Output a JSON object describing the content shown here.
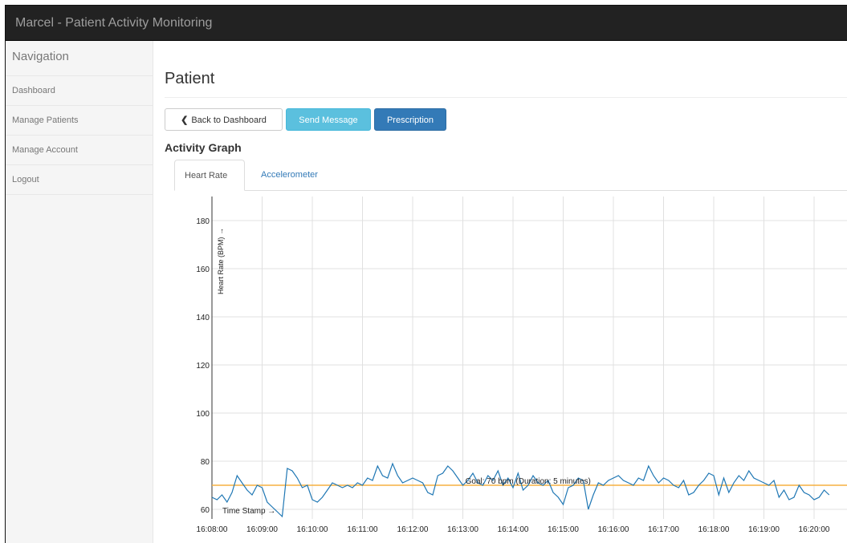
{
  "app": {
    "title": "Marcel - Patient Activity Monitoring"
  },
  "sidebar": {
    "heading": "Navigation",
    "items": [
      {
        "label": "Dashboard"
      },
      {
        "label": "Manage Patients"
      },
      {
        "label": "Manage Account"
      },
      {
        "label": "Logout"
      }
    ]
  },
  "main": {
    "title": "Patient",
    "buttons": {
      "back": "Back to Dashboard",
      "send_message": "Send Message",
      "prescription": "Prescription"
    },
    "section_title": "Activity Graph",
    "tabs": [
      {
        "label": "Heart Rate",
        "active": true
      },
      {
        "label": "Accelerometer",
        "active": false
      }
    ]
  },
  "colors": {
    "series": "#1f77b4",
    "goal": "#f5b041",
    "grid": "#e0e0e0",
    "primary": "#337ab7",
    "info": "#5bc0de"
  },
  "chart_data": {
    "type": "line",
    "ylabel": "Heart Rate (BPM) →",
    "xlabel": "Time Stamp →",
    "ylim": [
      56,
      190
    ],
    "y_ticks": [
      60,
      80,
      100,
      120,
      140,
      160,
      180
    ],
    "x_ticks": [
      "16:08:00",
      "16:09:00",
      "16:10:00",
      "16:11:00",
      "16:12:00",
      "16:13:00",
      "16:14:00",
      "16:15:00",
      "16:16:00",
      "16:17:00",
      "16:18:00",
      "16:19:00",
      "16:20:00"
    ],
    "xlim_minutes": [
      0,
      12.3
    ],
    "grid": true,
    "goal": {
      "value": 70,
      "label": "Goal: 70 bpm (Duration: 5 minutes)"
    },
    "series": [
      {
        "x": [
          0,
          0.1,
          0.2,
          0.3,
          0.4,
          0.5,
          0.6,
          0.7,
          0.8,
          0.9,
          1.0,
          1.1,
          1.2,
          1.3,
          1.4,
          1.5,
          1.6,
          1.7,
          1.8,
          1.9,
          2.0,
          2.1,
          2.2,
          2.3,
          2.4,
          2.5,
          2.6,
          2.7,
          2.8,
          2.9,
          3.0,
          3.1,
          3.2,
          3.3,
          3.4,
          3.5,
          3.6,
          3.7,
          3.8,
          3.9,
          4.0,
          4.1,
          4.2,
          4.3,
          4.4,
          4.5,
          4.6,
          4.7,
          4.8,
          4.9,
          5.0,
          5.1,
          5.2,
          5.3,
          5.4,
          5.5,
          5.6,
          5.7,
          5.8,
          5.9,
          6.0,
          6.1,
          6.2,
          6.3,
          6.4,
          6.5,
          6.6,
          6.7,
          6.8,
          6.9,
          7.0,
          7.1,
          7.2,
          7.3,
          7.4,
          7.5,
          7.6,
          7.7,
          7.8,
          7.9,
          8.0,
          8.1,
          8.2,
          8.3,
          8.4,
          8.5,
          8.6,
          8.7,
          8.8,
          8.9,
          9.0,
          9.1,
          9.2,
          9.3,
          9.4,
          9.5,
          9.6,
          9.7,
          9.8,
          9.9,
          10.0,
          10.1,
          10.2,
          10.3,
          10.4,
          10.5,
          10.6,
          10.7,
          10.8,
          10.9,
          11.0,
          11.1,
          11.2,
          11.3,
          11.4,
          11.5,
          11.6,
          11.7,
          11.8,
          11.9,
          12.0,
          12.1,
          12.2,
          12.3
        ],
        "values": [
          65,
          64,
          66,
          63,
          67,
          74,
          71,
          68,
          66,
          70,
          69,
          63,
          61,
          59,
          57,
          77,
          76,
          73,
          69,
          70,
          64,
          63,
          65,
          68,
          71,
          70,
          69,
          70,
          69,
          71,
          70,
          73,
          72,
          78,
          74,
          73,
          79,
          74,
          71,
          72,
          73,
          72,
          71,
          67,
          66,
          74,
          75,
          78,
          76,
          73,
          70,
          72,
          75,
          71,
          70,
          74,
          72,
          76,
          70,
          73,
          69,
          75,
          68,
          70,
          74,
          71,
          70,
          72,
          67,
          65,
          62,
          69,
          70,
          73,
          72,
          60,
          66,
          71,
          70,
          72,
          73,
          74,
          72,
          71,
          70,
          73,
          72,
          78,
          74,
          71,
          73,
          72,
          70,
          69,
          72,
          66,
          67,
          70,
          72,
          75,
          74,
          66,
          73,
          67,
          71,
          74,
          72,
          76,
          73,
          72,
          71,
          70,
          72,
          65,
          68,
          64,
          65,
          70,
          67,
          66,
          64,
          65,
          68,
          66
        ]
      }
    ]
  }
}
